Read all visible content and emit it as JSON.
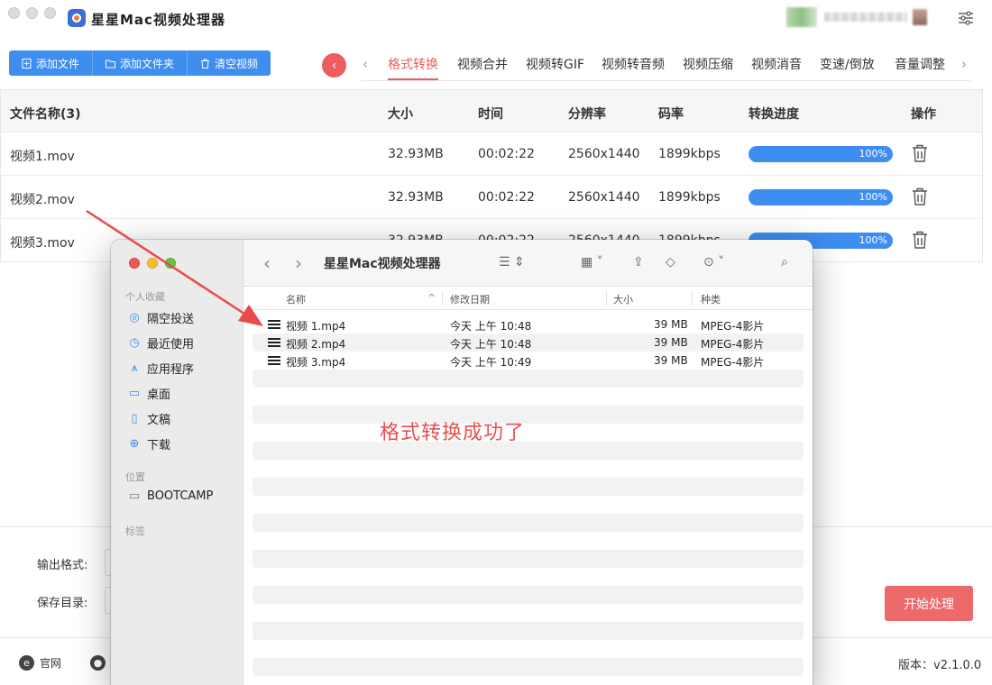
{
  "app": {
    "title": "星星Mac视频处理器"
  },
  "toolbar": {
    "add_file": "添加文件",
    "add_folder": "添加文件夹",
    "clear": "清空视频"
  },
  "tabs": [
    {
      "label": "格式转换",
      "active": true
    },
    {
      "label": "视频合并",
      "active": false
    },
    {
      "label": "视频转GIF",
      "active": false
    },
    {
      "label": "视频转音频",
      "active": false
    },
    {
      "label": "视频压缩",
      "active": false
    },
    {
      "label": "视频消音",
      "active": false
    },
    {
      "label": "变速/倒放",
      "active": false
    },
    {
      "label": "音量调整",
      "active": false
    }
  ],
  "table": {
    "headers": {
      "name": "文件名称(3)",
      "size": "大小",
      "time": "时间",
      "resolution": "分辨率",
      "bitrate": "码率",
      "progress": "转换进度",
      "action": "操作"
    },
    "rows": [
      {
        "name": "视频1.mov",
        "size": "32.93MB",
        "time": "00:02:22",
        "resolution": "2560x1440",
        "bitrate": "1899kbps",
        "progress": 1.0,
        "progress_label": "100%"
      },
      {
        "name": "视频2.mov",
        "size": "32.93MB",
        "time": "00:02:22",
        "resolution": "2560x1440",
        "bitrate": "1899kbps",
        "progress": 1.0,
        "progress_label": "100%"
      },
      {
        "name": "视频3.mov",
        "size": "32.93MB",
        "time": "00:02:22",
        "resolution": "2560x1440",
        "bitrate": "1899kbps",
        "progress": 1.0,
        "progress_label": "100%"
      }
    ]
  },
  "settings": {
    "output_format_label": "输出格式:",
    "save_dir_label": "保存目录:",
    "start_button": "开始处理"
  },
  "footer": {
    "website": "官网",
    "version": "版本：v2.1.0.0"
  },
  "finder": {
    "title": "星星Mac视频处理器",
    "sidebar": {
      "favorites_title": "个人收藏",
      "favorites": [
        {
          "label": "隔空投送",
          "icon": "airdrop-icon"
        },
        {
          "label": "最近使用",
          "icon": "clock-icon"
        },
        {
          "label": "应用程序",
          "icon": "apps-icon"
        },
        {
          "label": "桌面",
          "icon": "desktop-icon"
        },
        {
          "label": "文稿",
          "icon": "document-icon"
        },
        {
          "label": "下载",
          "icon": "download-icon"
        }
      ],
      "locations_title": "位置",
      "locations": [
        {
          "label": "BOOTCAMP",
          "icon": "drive-icon"
        }
      ],
      "tags_title": "标签"
    },
    "columns": {
      "name": "名称",
      "date": "修改日期",
      "size": "大小",
      "kind": "种类"
    },
    "files": [
      {
        "name": "视频 1.mp4",
        "date": "今天 上午 10:48",
        "size": "39 MB",
        "kind": "MPEG-4影片"
      },
      {
        "name": "视频 2.mp4",
        "date": "今天 上午 10:48",
        "size": "39 MB",
        "kind": "MPEG-4影片"
      },
      {
        "name": "视频 3.mp4",
        "date": "今天 上午 10:49",
        "size": "39 MB",
        "kind": "MPEG-4影片"
      }
    ],
    "annotation": "格式转换成功了"
  },
  "colors": {
    "accent_red": "#ee5d5d",
    "primary_blue": "#3e8ef0",
    "start_button": "#ee6a6a",
    "annotation_red": "#e84f4f"
  }
}
